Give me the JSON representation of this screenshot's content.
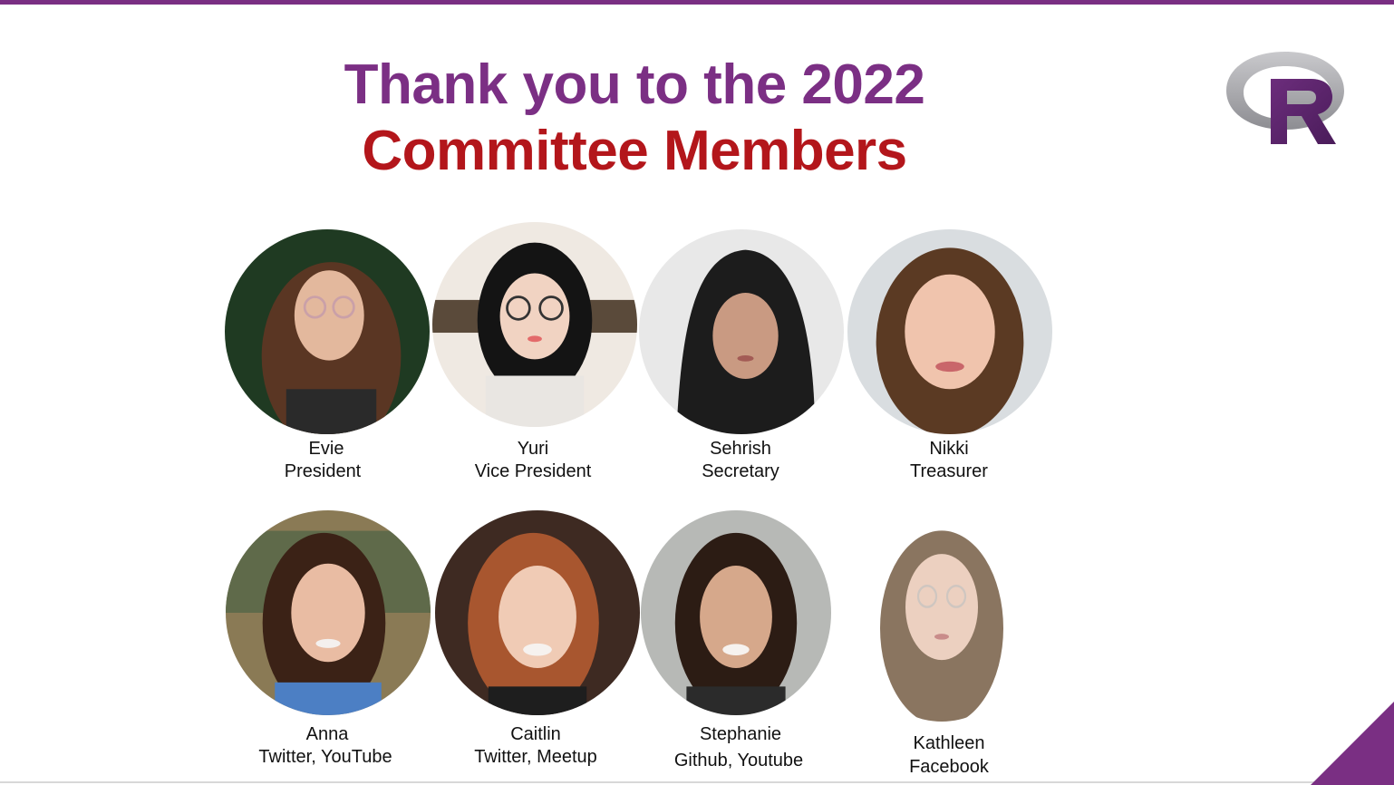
{
  "title": {
    "line1": "Thank you to the 2022",
    "line2": "Committee Members"
  },
  "logo": {
    "icon": "r-logo-icon",
    "letter": "R"
  },
  "colors": {
    "purple": "#7b2f84",
    "red": "#b3161b"
  },
  "members": [
    {
      "name": "Evie",
      "role": "President"
    },
    {
      "name": "Yuri",
      "role": "Vice President"
    },
    {
      "name": "Sehrish",
      "role": "Secretary"
    },
    {
      "name": "Nikki",
      "role": "Treasurer"
    },
    {
      "name": "Anna",
      "role": "Twitter,  YouTube"
    },
    {
      "name": "Caitlin",
      "role": "Twitter,  Meetup"
    },
    {
      "name": "Stephanie",
      "role": "Github, Youtube"
    },
    {
      "name": "Kathleen",
      "role": "Facebook"
    }
  ]
}
